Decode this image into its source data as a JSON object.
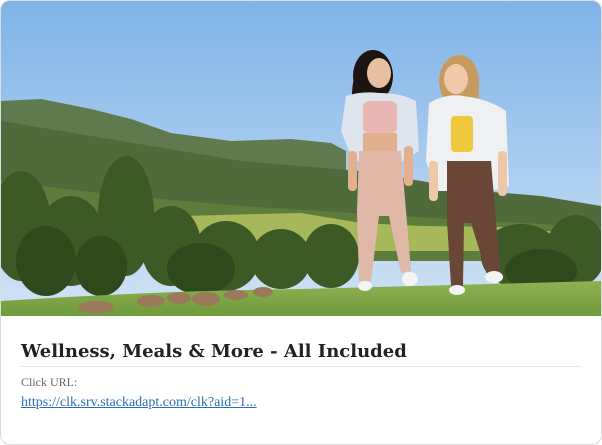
{
  "ad": {
    "image_alt": "Two women walking on a grassy hill with mountains and trees behind",
    "title": "Wellness, Meals & More - All Included",
    "click_url_label": "Click URL:",
    "click_url": "https://clk.srv.stackadapt.com/clk?aid=1..."
  },
  "colors": {
    "sky_top": "#7fb3e8",
    "sky_bottom": "#cfe3f5",
    "grass": "#7fa545",
    "link": "#2a6fb5",
    "title": "#222222"
  }
}
